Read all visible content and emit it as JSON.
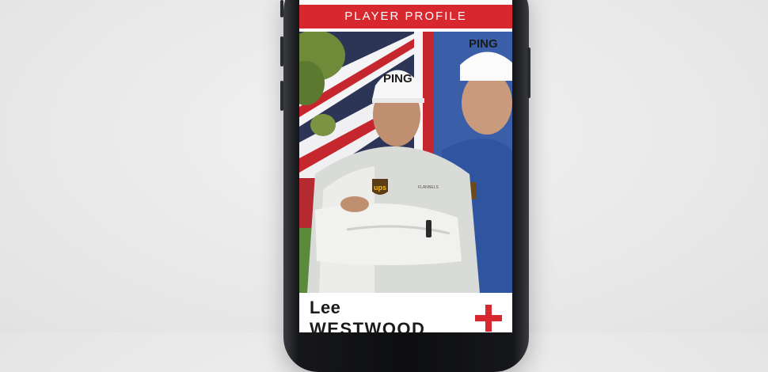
{
  "banner": {
    "title": "PLAYER PROFILE"
  },
  "player": {
    "first_name": "Lee",
    "last_name": "WESTWOOD"
  },
  "photo": {
    "cap_text_main": "PING",
    "cap_text_background": "PING",
    "sponsor_badge": "ups",
    "chest_text": "FLANNELS"
  },
  "colors": {
    "accent": "#d8282f",
    "banner_text": "#ffffff",
    "name_text": "#1b1b1b",
    "shirt_blue": "#3a5fa8"
  },
  "icons": {
    "expand": "plus-icon"
  }
}
